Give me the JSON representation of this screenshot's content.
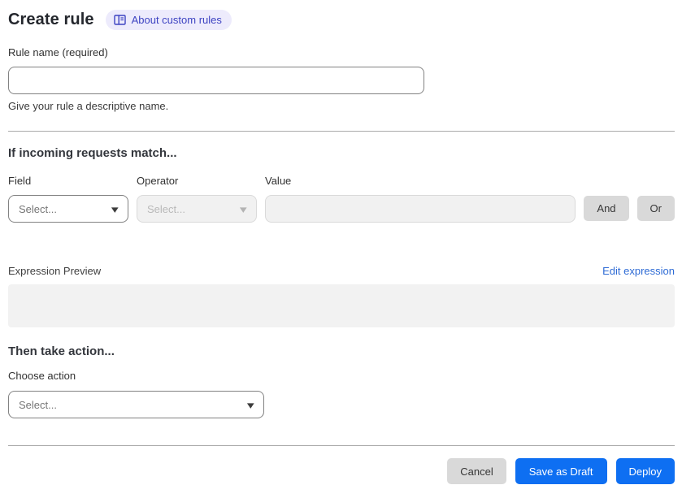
{
  "page": {
    "title": "Create rule",
    "about_badge": {
      "label": "About custom rules",
      "icon": "book-icon"
    }
  },
  "rule_name": {
    "label": "Rule name (required)",
    "value": "",
    "helper": "Give your rule a descriptive name."
  },
  "match_section": {
    "heading": "If incoming requests match...",
    "field": {
      "label": "Field",
      "selected": "Select...",
      "enabled": true
    },
    "operator": {
      "label": "Operator",
      "selected": "Select...",
      "enabled": false
    },
    "value": {
      "label": "Value",
      "value": "",
      "enabled": false
    },
    "and_button": "And",
    "or_button": "Or"
  },
  "expression": {
    "label": "Expression Preview",
    "edit_link": "Edit expression",
    "preview_value": ""
  },
  "action_section": {
    "heading": "Then take action...",
    "choose_label": "Choose action",
    "selected": "Select..."
  },
  "footer": {
    "cancel": "Cancel",
    "save_draft": "Save as Draft",
    "deploy": "Deploy"
  },
  "icons": {
    "dropdown_arrow": "▾"
  },
  "colors": {
    "primary_blue": "#0e6ff2",
    "link_blue": "#2e6bd5",
    "badge_bg": "#edebfc",
    "badge_text": "#3d43c2",
    "button_gray": "#d9d9d9",
    "disabled_bg": "#f1f1f1",
    "preview_bg": "#f2f2f2",
    "divider": "#ababab"
  }
}
